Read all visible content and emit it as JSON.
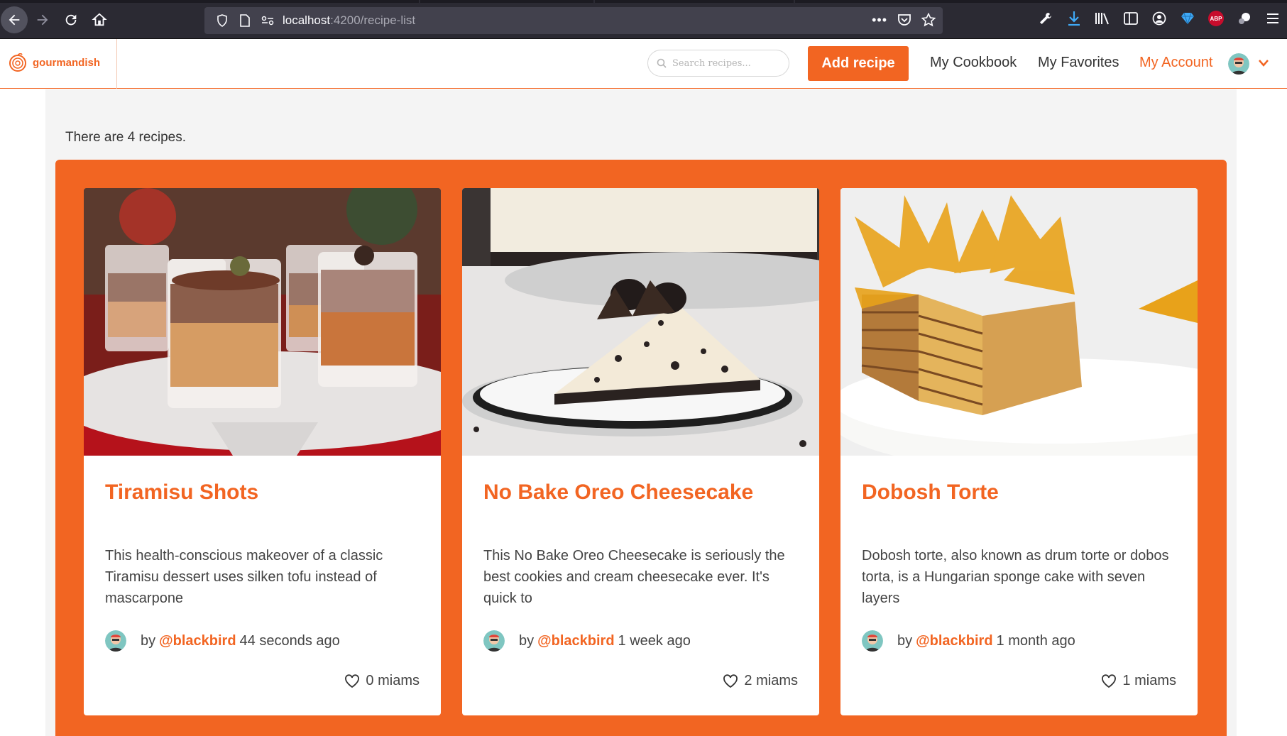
{
  "browser": {
    "url_host": "localhost",
    "url_path": ":4200/recipe-list",
    "abp_label": "ABP"
  },
  "header": {
    "logo_text": "gourmandish",
    "search_placeholder": "Search recipes...",
    "add_button": "Add recipe",
    "nav": [
      "My Cookbook",
      "My Favorites",
      "My Account"
    ],
    "accent_color": "#f26522"
  },
  "main": {
    "count_text": "There are 4 recipes."
  },
  "recipes": [
    {
      "title": "Tiramisu Shots",
      "description": "This health-conscious makeover of a classic Tiramisu dessert uses silken tofu instead of mascarpone",
      "by": "by",
      "author": "@blackbird",
      "time": "44 seconds ago",
      "miams": "0 miams",
      "image": "tiramisu-photo"
    },
    {
      "title": "No Bake Oreo Cheesecake",
      "description": "This No Bake Oreo Cheesecake is seriously the best cookies and cream cheesecake ever. It's quick to",
      "by": "by",
      "author": "@blackbird",
      "time": "1 week ago",
      "miams": "2 miams",
      "image": "cheesecake-photo"
    },
    {
      "title": "Dobosh Torte",
      "description": "Dobosh torte, also known as drum torte or dobos torta, is a Hungarian sponge cake with seven layers",
      "by": "by",
      "author": "@blackbird",
      "time": "1 month ago",
      "miams": "1 miams",
      "image": "torte-photo"
    }
  ]
}
